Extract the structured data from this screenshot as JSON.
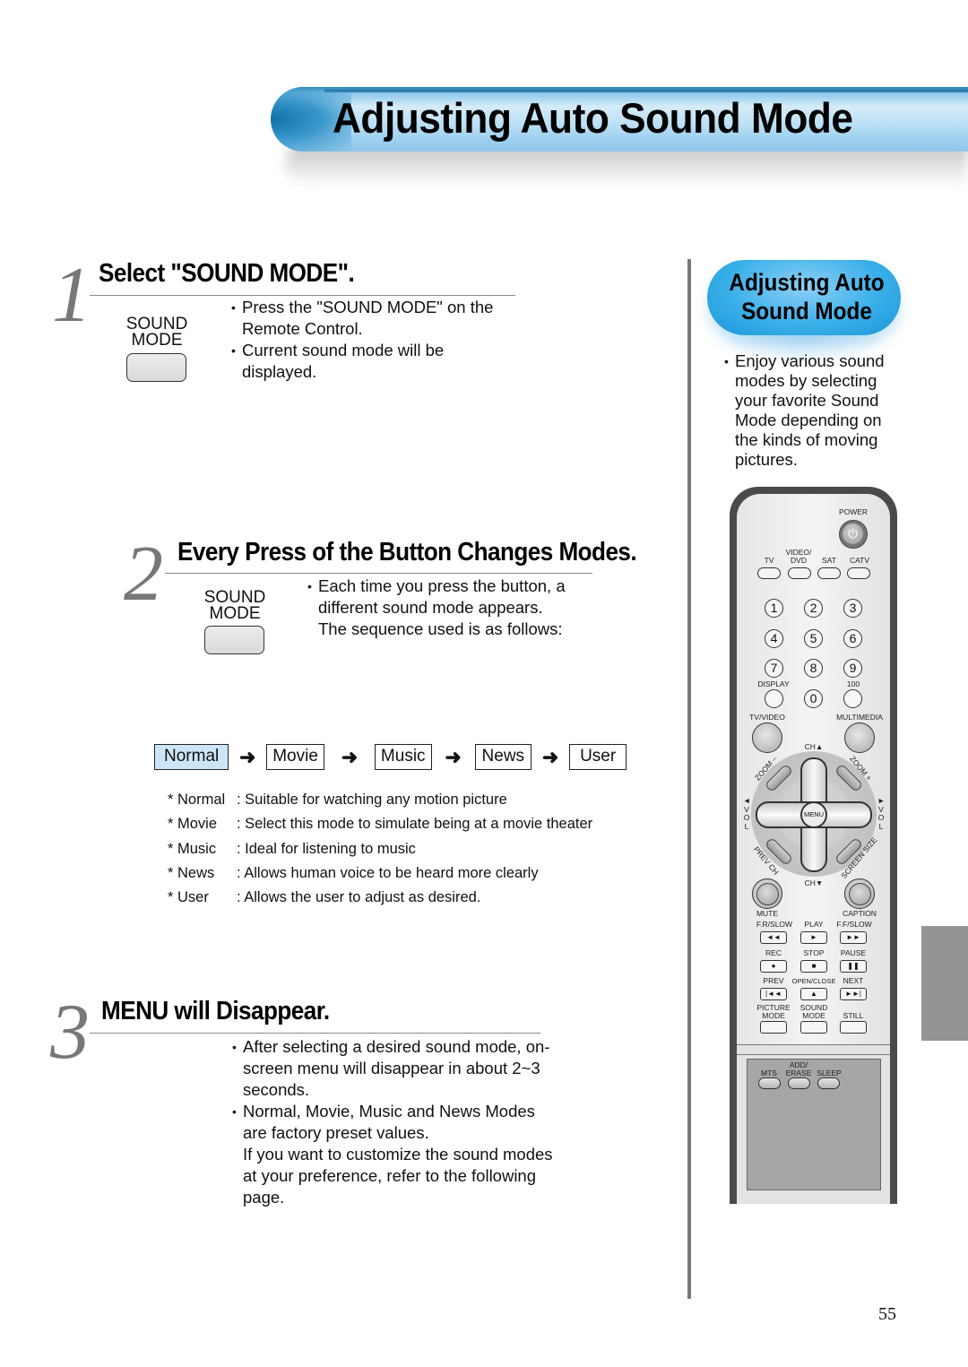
{
  "page": {
    "title": "Adjusting Auto Sound Mode",
    "page_number": "55"
  },
  "steps": [
    {
      "number": "1",
      "title": "Select \"SOUND MODE\".",
      "button_caption": [
        "SOUND",
        "MODE"
      ],
      "bullets": [
        {
          "lines": [
            "Press the \"SOUND MODE\" on the",
            "Remote Control."
          ]
        },
        {
          "lines": [
            "Current sound mode will be",
            "displayed."
          ]
        }
      ]
    },
    {
      "number": "2",
      "title": "Every Press of the Button Changes Modes.",
      "button_caption": [
        "SOUND",
        "MODE"
      ],
      "bullets": [
        {
          "lines": [
            "Each time you press the button, a",
            "different sound mode appears.",
            "The sequence used is as follows:"
          ]
        }
      ]
    },
    {
      "number": "3",
      "title": "MENU will Disappear.",
      "bullets": [
        {
          "lines": [
            "After selecting a desired sound mode, on-",
            "screen menu will disappear in about 2~3",
            "seconds."
          ]
        },
        {
          "lines": [
            "Normal, Movie, Music and News Modes",
            "are factory preset values.",
            "If you want to customize the sound modes",
            "at your preference, refer to the following",
            "page."
          ]
        }
      ]
    }
  ],
  "sequence": {
    "modes": [
      "Normal",
      "Movie",
      "Music",
      "News",
      "User"
    ],
    "active": "Normal",
    "arrow": "➜",
    "highlight_color": "#cde6f7"
  },
  "mode_descriptions": [
    {
      "name": "* Normal",
      "desc": ": Suitable for watching any motion picture"
    },
    {
      "name": "* Movie",
      "desc": ": Select this mode to simulate being at a movie theater"
    },
    {
      "name": "* Music",
      "desc": ": Ideal for listening to music"
    },
    {
      "name": "* News",
      "desc": ": Allows human voice to be heard more clearly"
    },
    {
      "name": "* User",
      "desc": ": Allows the user to adjust as desired."
    }
  ],
  "sidebar": {
    "pill_title": [
      "Adjusting Auto",
      "Sound Mode"
    ],
    "pill_color": "#2aa6e6",
    "bullet_lines": [
      "Enjoy various sound",
      "modes by selecting",
      "your favorite Sound",
      "Mode depending on",
      "the kinds of moving",
      "pictures."
    ]
  },
  "remote": {
    "power": "POWER",
    "power_glyph": "⏻",
    "source_buttons": [
      {
        "label": "TV"
      },
      {
        "label": "VIDEO/\nDVD"
      },
      {
        "label": "SAT"
      },
      {
        "label": "CATV"
      }
    ],
    "digits": [
      "1",
      "2",
      "3",
      "4",
      "5",
      "6",
      "7",
      "8",
      "9"
    ],
    "display": "DISPLAY",
    "zero": "0",
    "hundred": "100",
    "tv_video": "TV/VIDEO",
    "multimedia": "MULTIMEDIA",
    "ch_up": "CH▲",
    "ch_down": "CH▼",
    "zoom_minus": "ZOOM –",
    "zoom_plus": "ZOOM +",
    "prev_ch": "PREV CH",
    "screen_size": "SCREEN SIZE",
    "vol_left": [
      "◄",
      "V",
      "O",
      "L"
    ],
    "vol_right": [
      "►",
      "V",
      "O",
      "L"
    ],
    "menu": "MENU",
    "mute": "MUTE",
    "caption": "CAPTION",
    "transport": [
      {
        "label": "F.R/SLOW",
        "glyph": "◄◄"
      },
      {
        "label": "PLAY",
        "glyph": "►"
      },
      {
        "label": "F.F/SLOW",
        "glyph": "►►"
      },
      {
        "label": "REC",
        "glyph": "●"
      },
      {
        "label": "STOP",
        "glyph": "■"
      },
      {
        "label": "PAUSE",
        "glyph": "❚❚"
      },
      {
        "label": "PREV",
        "glyph": "|◄◄"
      },
      {
        "label": "OPEN/CLOSE",
        "glyph": "▲"
      },
      {
        "label": "NEXT",
        "glyph": "►►|"
      },
      {
        "label": "PICTURE\nMODE",
        "glyph": ""
      },
      {
        "label": "SOUND\nMODE",
        "glyph": ""
      },
      {
        "label": "STILL",
        "glyph": ""
      }
    ],
    "cover_buttons": [
      {
        "label": "MTS"
      },
      {
        "label": "ADD/\nERASE"
      },
      {
        "label": "SLEEP"
      }
    ]
  }
}
